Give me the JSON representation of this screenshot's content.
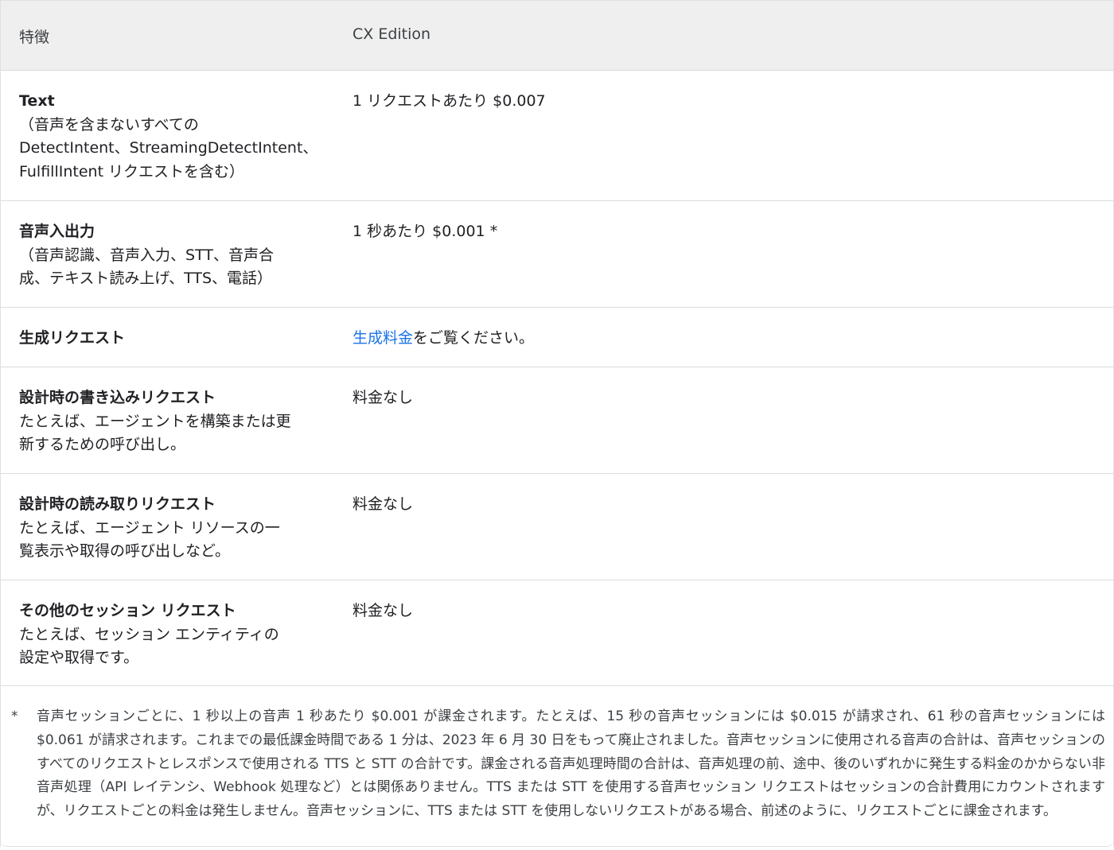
{
  "header": {
    "feature_label": "特徴",
    "edition_label": "CX Edition"
  },
  "rows": [
    {
      "title": "Text",
      "description": "（音声を含まないすべての\nDetectIntent、StreamingDetectIntent、\nFulfillIntent リクエストを含む）",
      "price": "1 リクエストあたり $0.007"
    },
    {
      "title": "音声入出力",
      "description": "（音声認識、音声入力、STT、音声合\n成、テキスト読み上げ、TTS、電話）",
      "price": "1 秒あたり $0.001 *"
    },
    {
      "title": "生成リクエスト",
      "description": "",
      "price_link": "生成料金",
      "price_suffix": "をご覧ください。"
    },
    {
      "title": "設計時の書き込みリクエスト",
      "description": "たとえば、エージェントを構築または更\n新するための呼び出し。",
      "price": "料金なし"
    },
    {
      "title": "設計時の読み取りリクエスト",
      "description": "たとえば、エージェント リソースの一\n覧表示や取得の呼び出しなど。",
      "price": "料金なし"
    },
    {
      "title": "その他のセッション リクエスト",
      "description": "たとえば、セッション エンティティの\n設定や取得です。",
      "price": "料金なし"
    }
  ],
  "footnote": {
    "mark": "*",
    "text": "音声セッションごとに、1 秒以上の音声 1 秒あたり $0.001 が課金されます。たとえば、15 秒の音声セッションには $0.015 が請求され、61 秒の音声セッションには $0.061 が請求されます。これまでの最低課金時間である 1 分は、2023 年 6 月 30 日をもって廃止されました。音声セッションに使用される音声の合計は、音声セッションのすべてのリクエストとレスポンスで使用される TTS と STT の合計です。課金される音声処理時間の合計は、音声処理の前、途中、後のいずれかに発生する料金のかからない非音声処理（API レイテンシ、Webhook 処理など）とは関係ありません。TTS または STT を使用する音声セッション リクエストはセッションの合計費用にカウントされますが、リクエストごとの料金は発生しません。音声セッションに、TTS または STT を使用しないリクエストがある場合、前述のように、リクエストごとに課金されます。"
  }
}
